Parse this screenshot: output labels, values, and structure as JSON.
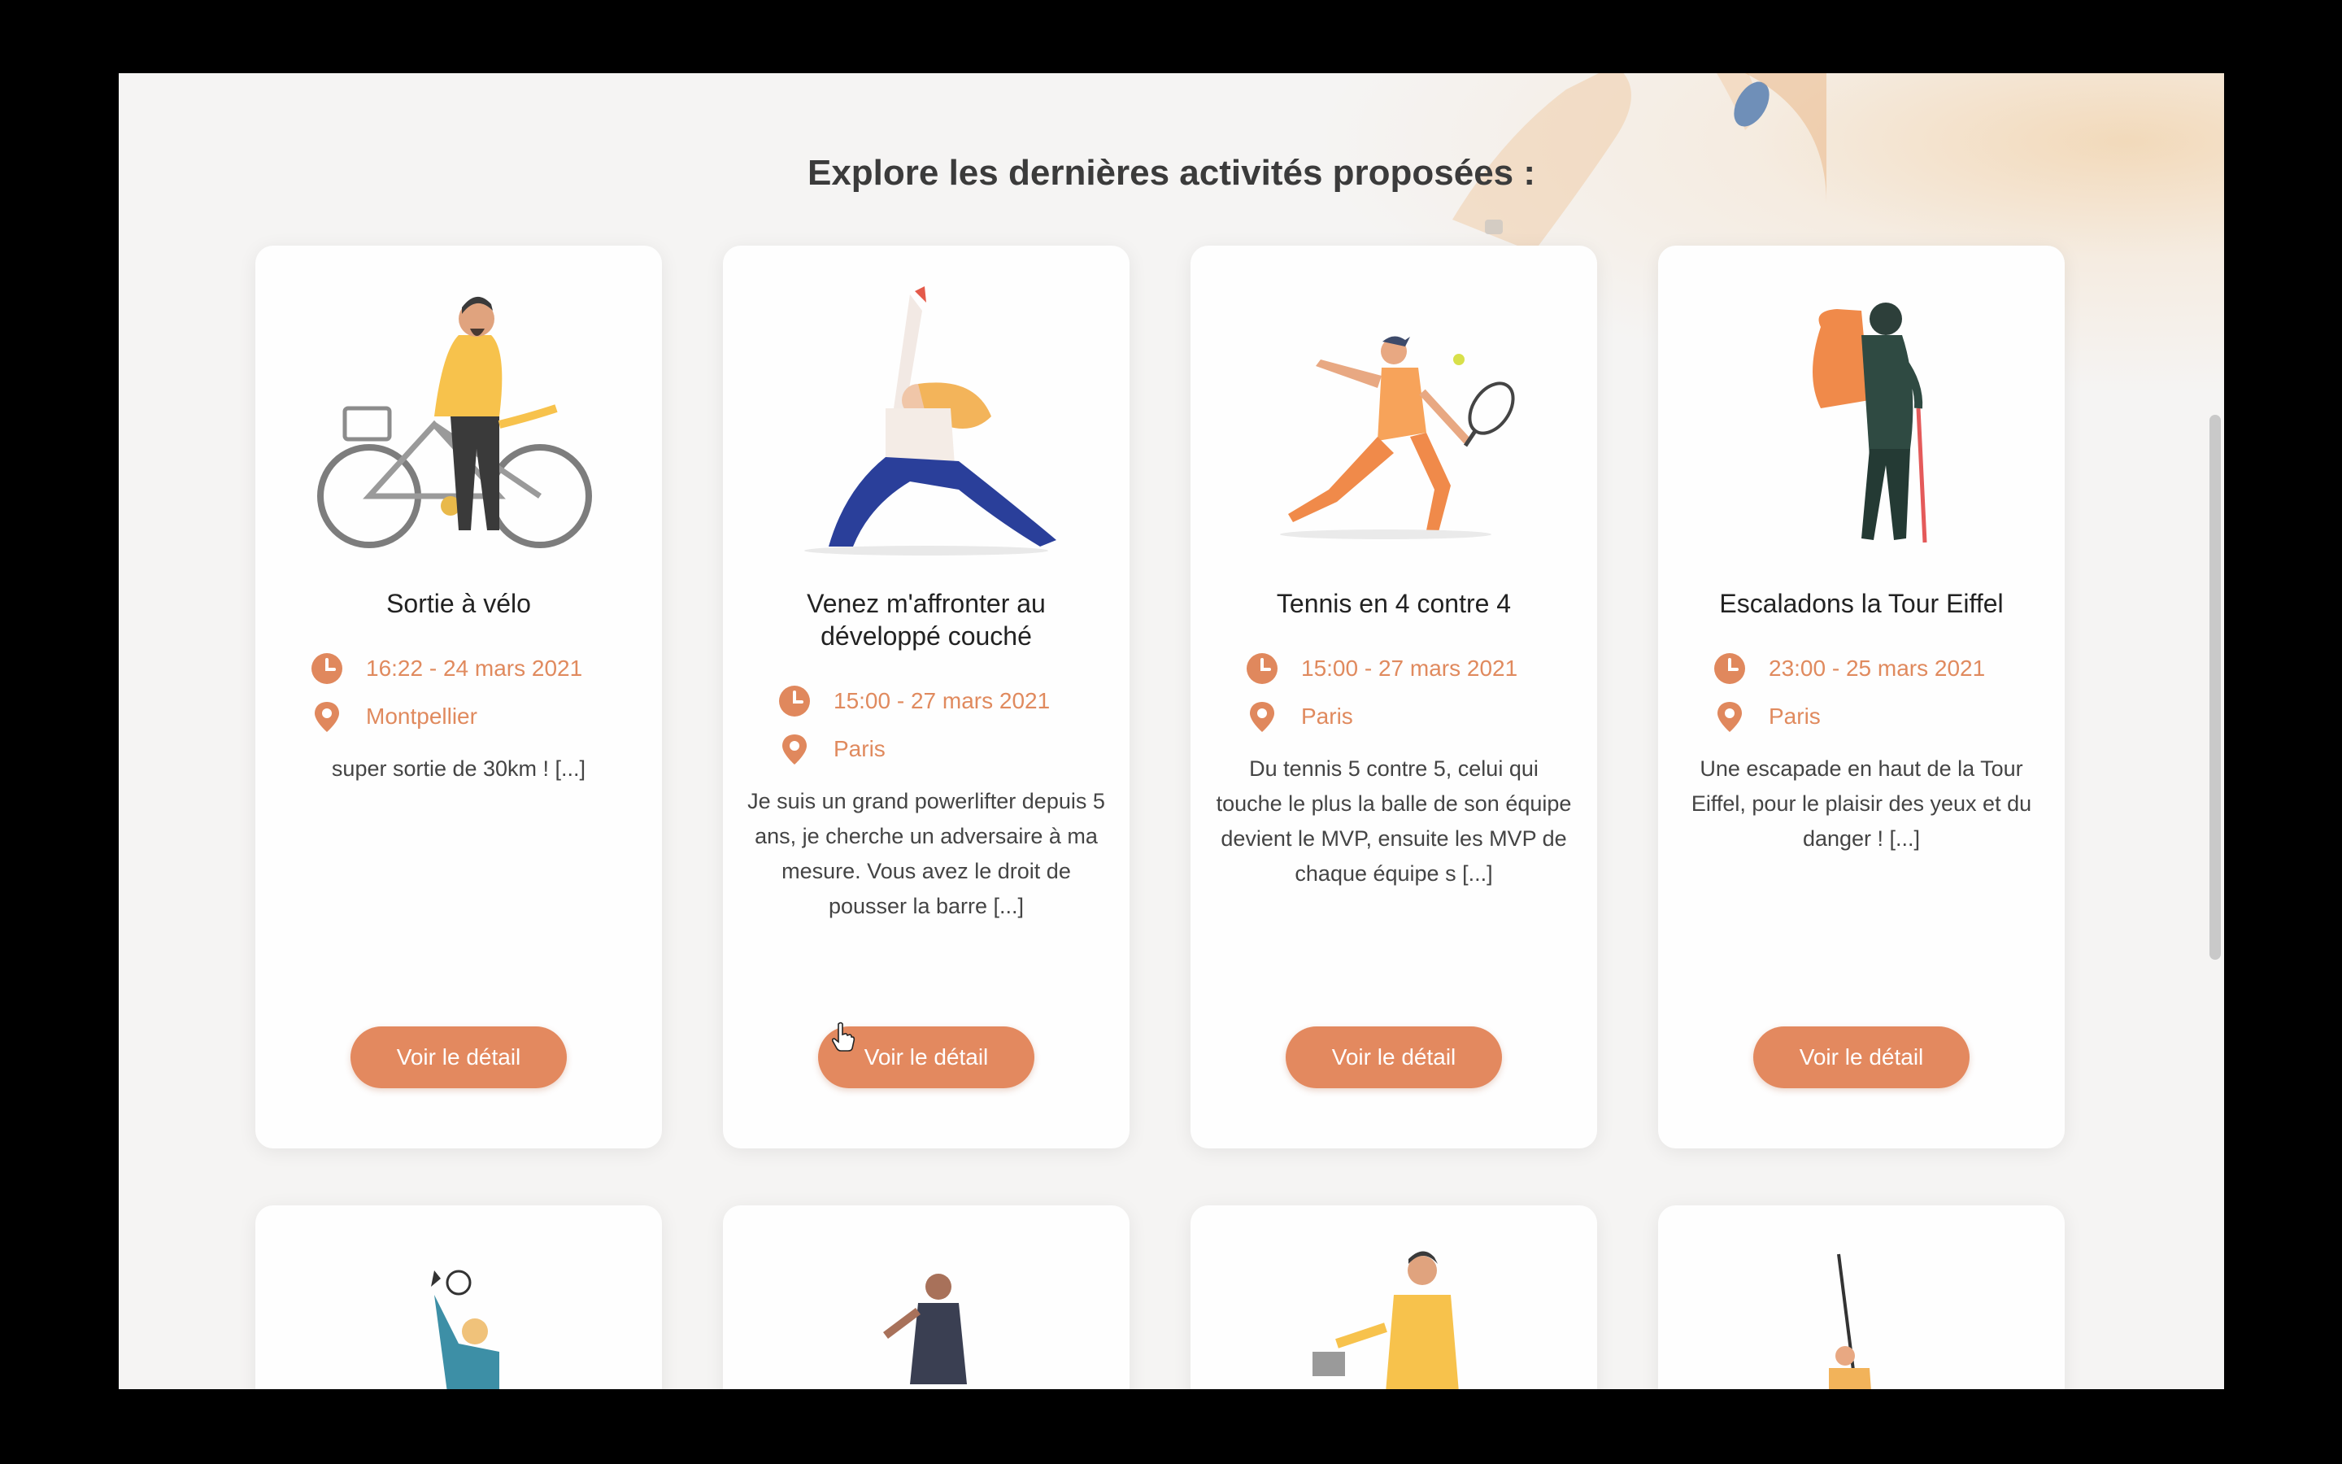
{
  "section_title": "Explore les dernières activités proposées :",
  "colors": {
    "accent": "#e3895f",
    "meta_text": "#e08a5e",
    "background": "#f5f4f3"
  },
  "cards": [
    {
      "title": "Sortie à vélo",
      "illustration": "man-with-bicycle",
      "time": "16:22 - 24 mars 2021",
      "location": "Montpellier",
      "description": "super sortie de 30km ! [...]",
      "button_label": "Voir le détail"
    },
    {
      "title": "Venez m'affronter au développé couché",
      "illustration": "woman-stretching",
      "time": "15:00 - 27 mars 2021",
      "location": "Paris",
      "description": "Je suis un grand powerlifter depuis 5 ans, je cherche un adversaire à ma mesure. Vous avez le droit de pousser la barre [...]",
      "button_label": "Voir le détail"
    },
    {
      "title": "Tennis en 4 contre 4",
      "illustration": "tennis-player",
      "time": "15:00 - 27 mars 2021",
      "location": "Paris",
      "description": "Du tennis 5 contre 5, celui qui touche le plus la balle de son équipe devient le MVP, ensuite les MVP de chaque équipe s [...]",
      "button_label": "Voir le détail"
    },
    {
      "title": "Escaladons la Tour Eiffel",
      "illustration": "hiker-with-backpack",
      "time": "23:00 - 25 mars 2021",
      "location": "Paris",
      "description": "Une escapade en haut de la Tour Eiffel, pour le plaisir des yeux et du danger ! [...]",
      "button_label": "Voir le détail"
    }
  ],
  "next_row_illustrations": [
    "football-player",
    "runner",
    "cyclist",
    "hiker-with-pole"
  ],
  "icons": {
    "time": "clock-icon",
    "location": "map-pin-icon"
  }
}
